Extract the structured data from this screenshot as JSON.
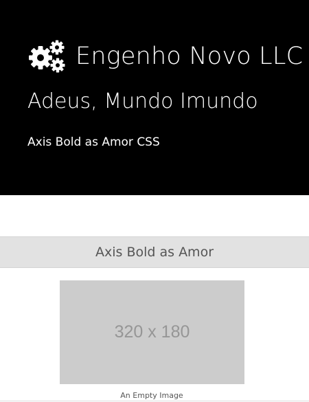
{
  "brand": {
    "icon": "gears-icon",
    "name": "Engenho Novo LLC"
  },
  "hero": {
    "title": "Adeus, Mundo Imundo",
    "subtitle": "Axis Bold as Amor CSS"
  },
  "section": {
    "heading": "Axis Bold as Amor"
  },
  "image": {
    "placeholder_text": "320 x 180",
    "caption": "An Empty Image"
  },
  "colors": {
    "hero_background": "#000000",
    "hero_text": "#ffffff",
    "section_bar": "#e2e2e2",
    "placeholder_fill": "#cccccc",
    "placeholder_text": "#969696"
  }
}
